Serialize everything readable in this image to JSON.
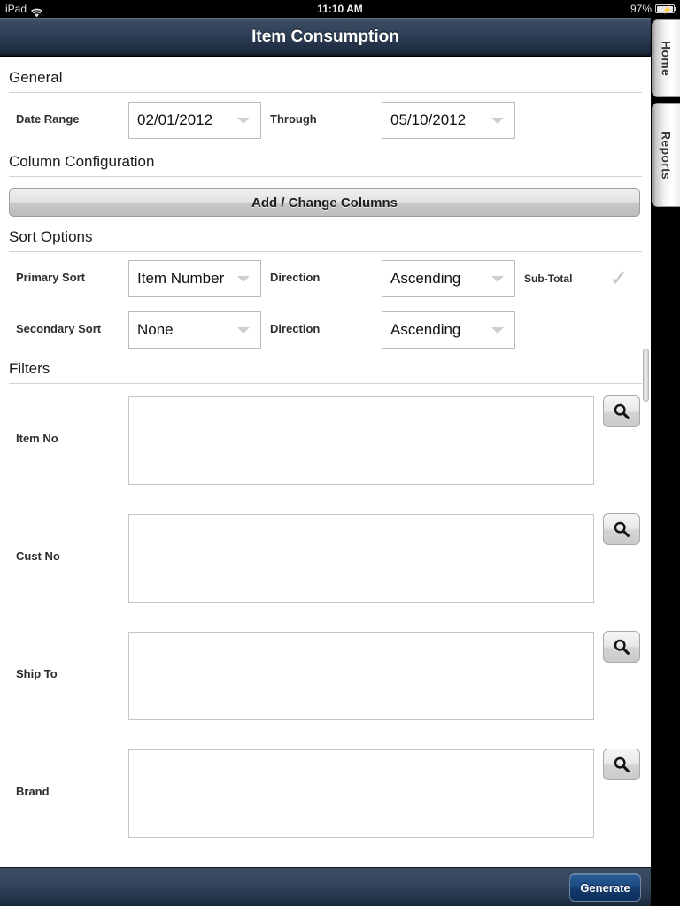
{
  "status_bar": {
    "device": "iPad",
    "wifi_icon": "wifi-icon",
    "time": "11:10 AM",
    "battery_percent": "97%",
    "battery_icon": "battery-charging-icon"
  },
  "header": {
    "title": "Item Consumption"
  },
  "side_tabs": [
    {
      "label": "Home",
      "name": "side-tab-home"
    },
    {
      "label": "Reports",
      "name": "side-tab-reports"
    }
  ],
  "sections": {
    "general": {
      "heading": "General",
      "date_range_label": "Date Range",
      "date_from": "02/01/2012",
      "through_label": "Through",
      "date_to": "05/10/2012"
    },
    "column_configuration": {
      "heading": "Column Configuration",
      "button_label": "Add / Change Columns"
    },
    "sort_options": {
      "heading": "Sort Options",
      "primary": {
        "label": "Primary Sort",
        "value": "Item Number",
        "direction_label": "Direction",
        "direction_value": "Ascending",
        "subtotal_label": "Sub-Total",
        "subtotal_checked": "✓"
      },
      "secondary": {
        "label": "Secondary Sort",
        "value": "None",
        "direction_label": "Direction",
        "direction_value": "Ascending"
      }
    },
    "filters": {
      "heading": "Filters",
      "rows": [
        {
          "label": "Item No",
          "value": "",
          "search_icon": "search-icon"
        },
        {
          "label": "Cust No",
          "value": "",
          "search_icon": "search-icon"
        },
        {
          "label": "Ship To",
          "value": "",
          "search_icon": "search-icon"
        },
        {
          "label": "Brand",
          "value": "",
          "search_icon": "search-icon"
        }
      ]
    }
  },
  "bottom_bar": {
    "generate_label": "Generate"
  },
  "colors": {
    "titlebar_navy": "#2c3d54",
    "generate_blue": "#1d4d86",
    "field_border": "#b9b9b9",
    "check_gray": "#c6c6c6"
  }
}
